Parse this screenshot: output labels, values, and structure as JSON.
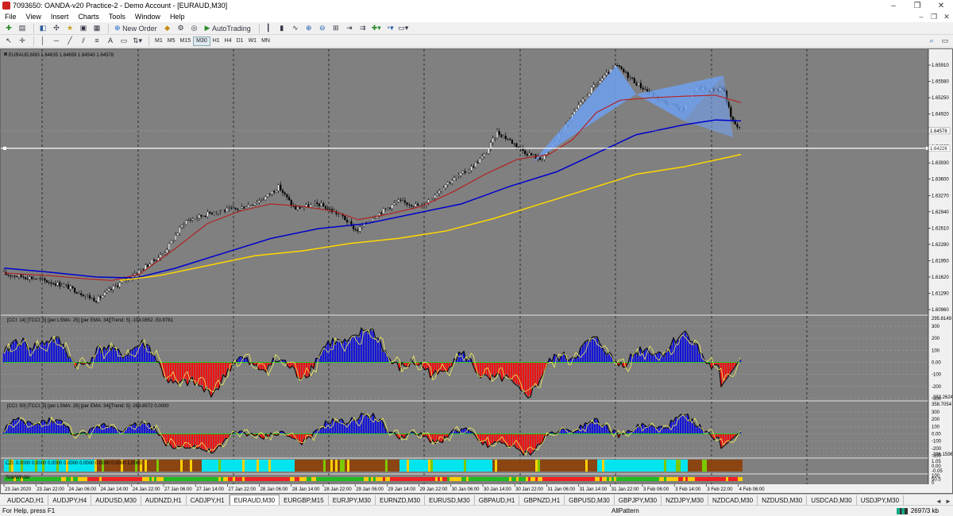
{
  "window": {
    "title": "7093650: OANDA-v20 Practice-2 - Demo Account - [EURAUD,M30]",
    "controls": {
      "minimize": "–",
      "restore": "❐",
      "close": "✕"
    }
  },
  "menu": {
    "items": [
      "File",
      "View",
      "Insert",
      "Charts",
      "Tools",
      "Window",
      "Help"
    ],
    "mdi": {
      "minimize": "–",
      "restore": "❐",
      "close": "✕"
    }
  },
  "toolbar": {
    "new_order": "New Order",
    "autotrading": "AutoTrading",
    "draw_text": "A",
    "timeframes": [
      "M1",
      "M5",
      "M15",
      "M30",
      "H1",
      "H4",
      "D1",
      "W1",
      "MN"
    ],
    "active_timeframe": "M30"
  },
  "chart": {
    "main_label": "EURAUD,M30 1.64635 1.64659 1.64540 1.64578",
    "price_axis": [
      "1.65910",
      "1.65580",
      "1.65250",
      "1.64920",
      "1.64590",
      "1.64260",
      "1.63930",
      "1.63600",
      "1.63270",
      "1.62940",
      "1.62610",
      "1.62280",
      "1.61950",
      "1.61620",
      "1.61290",
      "1.60960"
    ],
    "current_price": "1.64578",
    "hline_price": "1.64226",
    "cci1_label": "[CCI: 14] [TCCI: 5] [per LSMA: 25] [per EMA: 34][Trend: 5]  -104.0852 -53.9781",
    "cci1_axis": [
      "295.8149",
      "300",
      "200",
      "100",
      "0.00",
      "-100",
      "-200",
      "-300",
      "-382.2624"
    ],
    "cci2_label": "[CCI: 50] [TCCI: 5] [per LSMA: 25] [per EMA: 34][Trend: 5]  -288.8572 0.0000",
    "cci2_axis": [
      "358.7054",
      "300",
      "200",
      "100",
      "0.00",
      "-100",
      "-200",
      "-300",
      "-396.1596"
    ],
    "czi_label": "CZI: 0.0000 0.0000 0.0000 0.0000 0.0000 0.0000 0.0000 1.0000",
    "czi_axis": [
      "1.05",
      "0.00",
      "-0.05"
    ],
    "sw_label": "SideWinder",
    "sw_axis": [
      "100",
      "50.5",
      "0"
    ],
    "time_axis": [
      "23 Jan 2020",
      "23 Jan 22:00",
      "24 Jan 06:00",
      "24 Jan 14:00",
      "24 Jan 22:00",
      "27 Jan 06:00",
      "27 Jan 14:00",
      "27 Jan 22:00",
      "28 Jan 06:00",
      "28 Jan 14:00",
      "28 Jan 22:00",
      "29 Jan 06:00",
      "29 Jan 14:00",
      "29 Jan 22:00",
      "30 Jan 06:00",
      "30 Jan 14:00",
      "30 Jan 22:00",
      "31 Jan 06:00",
      "31 Jan 14:00",
      "31 Jan 22:00",
      "3 Feb 06:00",
      "3 Feb 14:00",
      "3 Feb 22:00",
      "4 Feb 06:00"
    ]
  },
  "tabs": {
    "items": [
      "AUDCAD,H1",
      "AUDJPY,H4",
      "AUDUSD,M30",
      "AUDNZD,H1",
      "CADJPY,H1",
      "EURAUD,M30",
      "EURGBP,M15",
      "EURJPY,M30",
      "EURNZD,M30",
      "EURUSD,M30",
      "GBPAUD,H1",
      "GBPNZD,H1",
      "GBPUSD,M30",
      "GBPJPY,M30",
      "NZDJPY,M30",
      "NZDCAD,M30",
      "NZDUSD,M30",
      "USDCAD,M30",
      "USDJPY,M30"
    ],
    "active": "EURAUD,M30",
    "scroll_left": "◄",
    "scroll_right": "►"
  },
  "status": {
    "help": "For Help, press F1",
    "profile": "AllPattern",
    "traffic": "2697/3 kb"
  },
  "colors": {
    "chart_bg": "#808080",
    "ema_red": "#b22222",
    "ema_blue": "#0000cd",
    "ema_yellow": "#ffd700",
    "pattern_fill": "#6fa0f0",
    "cci_blue": "#1515d8",
    "cci_red": "#ee1111",
    "cci_yellow": "#ffff55",
    "czi_cyan": "#00e5ee",
    "czi_brown": "#8b4513"
  }
}
